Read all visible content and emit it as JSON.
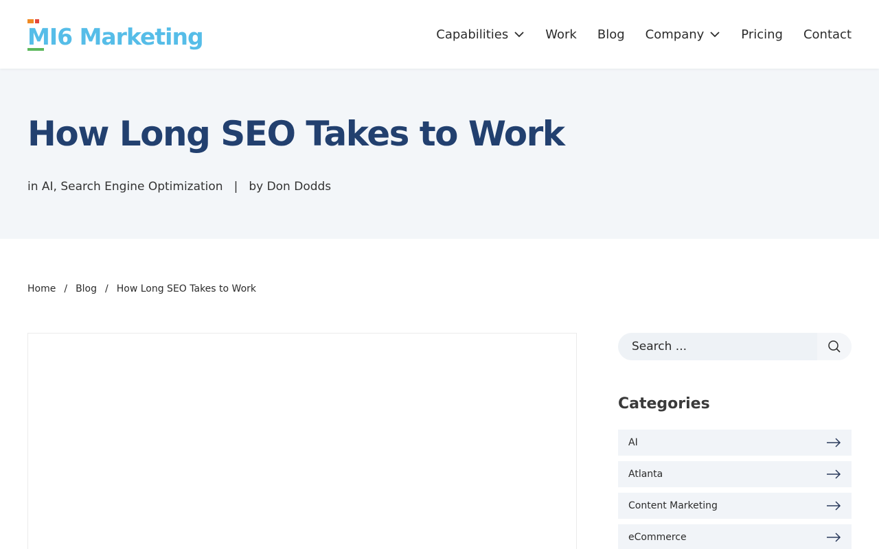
{
  "brand": {
    "name": "MI6 Marketing",
    "color": "#56bde8"
  },
  "nav": {
    "items": [
      {
        "label": "Capabilities",
        "has_dropdown": true
      },
      {
        "label": "Work",
        "has_dropdown": false
      },
      {
        "label": "Blog",
        "has_dropdown": false
      },
      {
        "label": "Company",
        "has_dropdown": true
      },
      {
        "label": "Pricing",
        "has_dropdown": false
      },
      {
        "label": "Contact",
        "has_dropdown": false
      }
    ]
  },
  "hero": {
    "title": "How Long SEO Takes to Work",
    "meta_categories": "in AI, Search Engine Optimization",
    "meta_separator": "|",
    "meta_author": "by Don Dodds",
    "title_color": "#22406f"
  },
  "breadcrumb": {
    "items": [
      "Home",
      "Blog",
      "How Long SEO Takes to Work"
    ],
    "separator": "/"
  },
  "sidebar": {
    "search_placeholder": "Search ...",
    "categories_heading": "Categories",
    "categories": [
      "AI",
      "Atlanta",
      "Content Marketing",
      "eCommerce"
    ]
  },
  "icons": {
    "search": "search-icon",
    "dropdown": "chevron-down-icon",
    "category_arrow": "arrow-right-icon"
  }
}
